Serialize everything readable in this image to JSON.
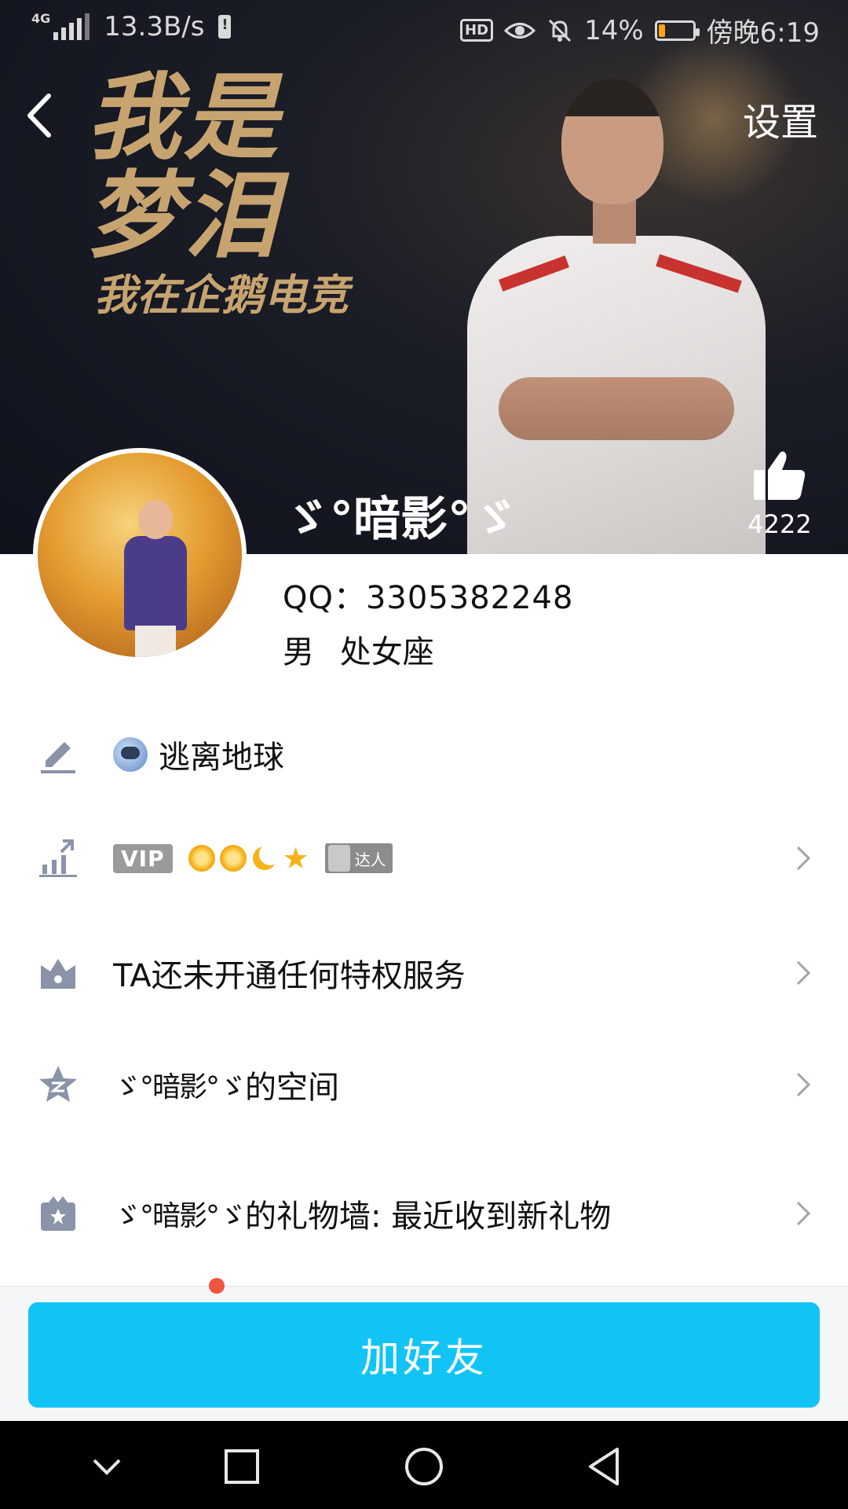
{
  "status_bar": {
    "network": "4G",
    "speed": "13.3B/s",
    "hd": "HD",
    "battery_percent": "14%",
    "time": "傍晚6:19"
  },
  "header": {
    "settings_label": "设置",
    "cover_text": [
      "我是",
      "梦泪",
      "我在企鹅电竞"
    ],
    "likes_count": "4222",
    "nickname": "ゞ°暗影°ゞ"
  },
  "profile": {
    "qq_line": "QQ：3305382248",
    "gender": "男",
    "zodiac": "处女座"
  },
  "rows": {
    "signature": "逃离地球",
    "vip_label": "VIP",
    "daren_label": "达人",
    "privilege": "TA还未开通任何特权服务",
    "space_name": "ゞ°暗影°ゞ",
    "space_suffix": "的空间",
    "gift_name": "ゞ°暗影°ゞ",
    "gift_suffix": "的礼物墙: 最近收到新礼物"
  },
  "bottom": {
    "add_friend_label": "加好友"
  },
  "colors": {
    "accent": "#12c4f6",
    "icon_gray": "#8a93a8",
    "battery_low": "#ffa21c"
  },
  "icons": [
    "back-arrow-icon",
    "thumbs-up-icon",
    "pencil-icon",
    "level-chart-icon",
    "crown-icon",
    "qzone-star-icon",
    "gift-icon",
    "chevron-right-icon"
  ]
}
